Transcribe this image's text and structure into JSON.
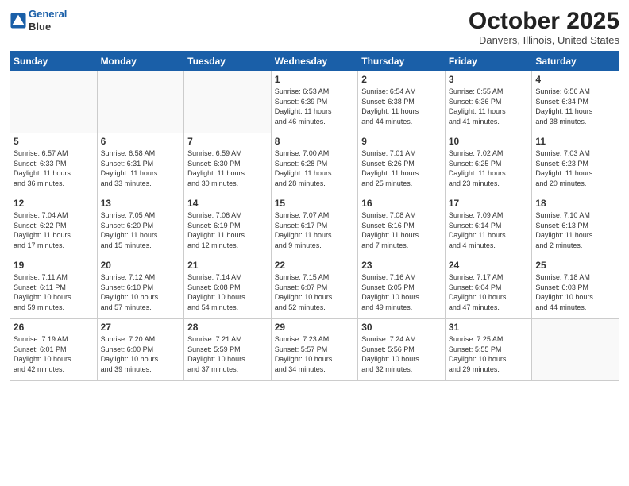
{
  "header": {
    "logo_line1": "General",
    "logo_line2": "Blue",
    "month_title": "October 2025",
    "location": "Danvers, Illinois, United States"
  },
  "days_of_week": [
    "Sunday",
    "Monday",
    "Tuesday",
    "Wednesday",
    "Thursday",
    "Friday",
    "Saturday"
  ],
  "weeks": [
    [
      {
        "num": "",
        "info": ""
      },
      {
        "num": "",
        "info": ""
      },
      {
        "num": "",
        "info": ""
      },
      {
        "num": "1",
        "info": "Sunrise: 6:53 AM\nSunset: 6:39 PM\nDaylight: 11 hours\nand 46 minutes."
      },
      {
        "num": "2",
        "info": "Sunrise: 6:54 AM\nSunset: 6:38 PM\nDaylight: 11 hours\nand 44 minutes."
      },
      {
        "num": "3",
        "info": "Sunrise: 6:55 AM\nSunset: 6:36 PM\nDaylight: 11 hours\nand 41 minutes."
      },
      {
        "num": "4",
        "info": "Sunrise: 6:56 AM\nSunset: 6:34 PM\nDaylight: 11 hours\nand 38 minutes."
      }
    ],
    [
      {
        "num": "5",
        "info": "Sunrise: 6:57 AM\nSunset: 6:33 PM\nDaylight: 11 hours\nand 36 minutes."
      },
      {
        "num": "6",
        "info": "Sunrise: 6:58 AM\nSunset: 6:31 PM\nDaylight: 11 hours\nand 33 minutes."
      },
      {
        "num": "7",
        "info": "Sunrise: 6:59 AM\nSunset: 6:30 PM\nDaylight: 11 hours\nand 30 minutes."
      },
      {
        "num": "8",
        "info": "Sunrise: 7:00 AM\nSunset: 6:28 PM\nDaylight: 11 hours\nand 28 minutes."
      },
      {
        "num": "9",
        "info": "Sunrise: 7:01 AM\nSunset: 6:26 PM\nDaylight: 11 hours\nand 25 minutes."
      },
      {
        "num": "10",
        "info": "Sunrise: 7:02 AM\nSunset: 6:25 PM\nDaylight: 11 hours\nand 23 minutes."
      },
      {
        "num": "11",
        "info": "Sunrise: 7:03 AM\nSunset: 6:23 PM\nDaylight: 11 hours\nand 20 minutes."
      }
    ],
    [
      {
        "num": "12",
        "info": "Sunrise: 7:04 AM\nSunset: 6:22 PM\nDaylight: 11 hours\nand 17 minutes."
      },
      {
        "num": "13",
        "info": "Sunrise: 7:05 AM\nSunset: 6:20 PM\nDaylight: 11 hours\nand 15 minutes."
      },
      {
        "num": "14",
        "info": "Sunrise: 7:06 AM\nSunset: 6:19 PM\nDaylight: 11 hours\nand 12 minutes."
      },
      {
        "num": "15",
        "info": "Sunrise: 7:07 AM\nSunset: 6:17 PM\nDaylight: 11 hours\nand 9 minutes."
      },
      {
        "num": "16",
        "info": "Sunrise: 7:08 AM\nSunset: 6:16 PM\nDaylight: 11 hours\nand 7 minutes."
      },
      {
        "num": "17",
        "info": "Sunrise: 7:09 AM\nSunset: 6:14 PM\nDaylight: 11 hours\nand 4 minutes."
      },
      {
        "num": "18",
        "info": "Sunrise: 7:10 AM\nSunset: 6:13 PM\nDaylight: 11 hours\nand 2 minutes."
      }
    ],
    [
      {
        "num": "19",
        "info": "Sunrise: 7:11 AM\nSunset: 6:11 PM\nDaylight: 10 hours\nand 59 minutes."
      },
      {
        "num": "20",
        "info": "Sunrise: 7:12 AM\nSunset: 6:10 PM\nDaylight: 10 hours\nand 57 minutes."
      },
      {
        "num": "21",
        "info": "Sunrise: 7:14 AM\nSunset: 6:08 PM\nDaylight: 10 hours\nand 54 minutes."
      },
      {
        "num": "22",
        "info": "Sunrise: 7:15 AM\nSunset: 6:07 PM\nDaylight: 10 hours\nand 52 minutes."
      },
      {
        "num": "23",
        "info": "Sunrise: 7:16 AM\nSunset: 6:05 PM\nDaylight: 10 hours\nand 49 minutes."
      },
      {
        "num": "24",
        "info": "Sunrise: 7:17 AM\nSunset: 6:04 PM\nDaylight: 10 hours\nand 47 minutes."
      },
      {
        "num": "25",
        "info": "Sunrise: 7:18 AM\nSunset: 6:03 PM\nDaylight: 10 hours\nand 44 minutes."
      }
    ],
    [
      {
        "num": "26",
        "info": "Sunrise: 7:19 AM\nSunset: 6:01 PM\nDaylight: 10 hours\nand 42 minutes."
      },
      {
        "num": "27",
        "info": "Sunrise: 7:20 AM\nSunset: 6:00 PM\nDaylight: 10 hours\nand 39 minutes."
      },
      {
        "num": "28",
        "info": "Sunrise: 7:21 AM\nSunset: 5:59 PM\nDaylight: 10 hours\nand 37 minutes."
      },
      {
        "num": "29",
        "info": "Sunrise: 7:23 AM\nSunset: 5:57 PM\nDaylight: 10 hours\nand 34 minutes."
      },
      {
        "num": "30",
        "info": "Sunrise: 7:24 AM\nSunset: 5:56 PM\nDaylight: 10 hours\nand 32 minutes."
      },
      {
        "num": "31",
        "info": "Sunrise: 7:25 AM\nSunset: 5:55 PM\nDaylight: 10 hours\nand 29 minutes."
      },
      {
        "num": "",
        "info": ""
      }
    ]
  ]
}
